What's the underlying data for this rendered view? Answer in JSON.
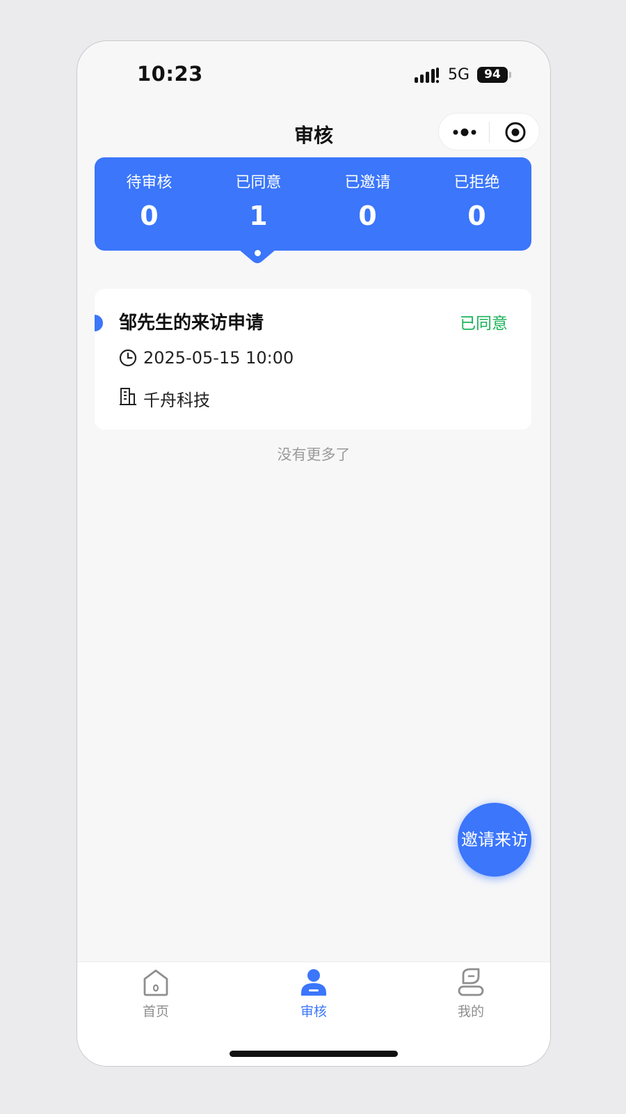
{
  "status_bar": {
    "time": "10:23",
    "network": "5G",
    "battery": "94"
  },
  "nav": {
    "title": "审核"
  },
  "stats": [
    {
      "label": "待审核",
      "value": "0"
    },
    {
      "label": "已同意",
      "value": "1"
    },
    {
      "label": "已邀请",
      "value": "0"
    },
    {
      "label": "已拒绝",
      "value": "0"
    }
  ],
  "selected_stat": "已同意",
  "records": [
    {
      "title": "邹先生的来访申请",
      "status": "已同意",
      "datetime": "2025-05-15 10:00",
      "company": "千舟科技",
      "clock_icon": "clock-icon",
      "company_icon": "building-icon"
    }
  ],
  "list_footer": "没有更多了",
  "fab_label": "邀请来访",
  "tabbar": [
    {
      "label": "首页",
      "icon": "home-icon",
      "active": false
    },
    {
      "label": "审核",
      "icon": "person-badge-icon",
      "active": true
    },
    {
      "label": "我的",
      "icon": "profile-icon",
      "active": false
    }
  ],
  "colors": {
    "primary": "#3b76fb",
    "approved": "#19b35a",
    "muted": "#9a9a9a"
  }
}
